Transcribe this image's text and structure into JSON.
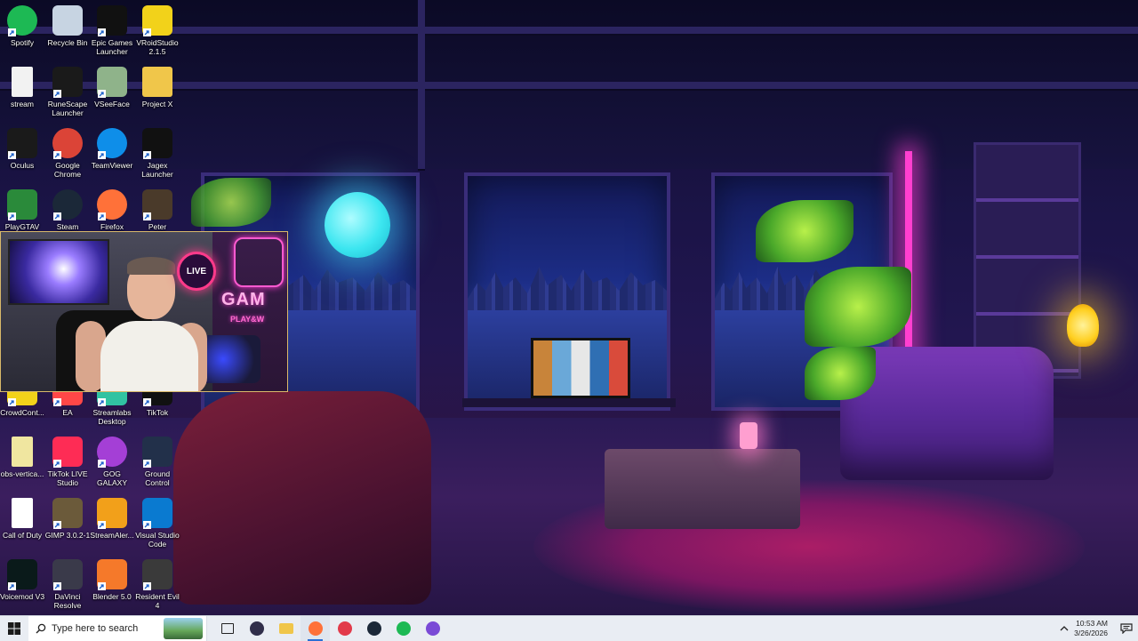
{
  "desktop_icons": [
    {
      "label": "Spotify",
      "icon": "spotify-icon",
      "color": "#1db954"
    },
    {
      "label": "Recycle Bin",
      "icon": "recycle-bin-icon",
      "color": "#c7d4e2"
    },
    {
      "label": "Epic Games Launcher",
      "icon": "epic-games-icon",
      "color": "#111111"
    },
    {
      "label": "VRoidStudio 2.1.5",
      "icon": "vroid-icon",
      "color": "#f2d21a"
    },
    {
      "label": "stream",
      "icon": "file-icon",
      "color": "#f2f2f2"
    },
    {
      "label": "RuneScape Launcher",
      "icon": "runescape-icon",
      "color": "#1a1a1a"
    },
    {
      "label": "VSeeFace",
      "icon": "vseeface-icon",
      "color": "#8fb38a"
    },
    {
      "label": "Project X",
      "icon": "folder-icon",
      "color": "#f0c64a"
    },
    {
      "label": "Oculus",
      "icon": "oculus-icon",
      "color": "#1a1a1a"
    },
    {
      "label": "Google Chrome",
      "icon": "chrome-icon",
      "color": "#db4437"
    },
    {
      "label": "TeamViewer",
      "icon": "teamviewer-icon",
      "color": "#0e8ee9"
    },
    {
      "label": "Jagex Launcher",
      "icon": "jagex-icon",
      "color": "#111111"
    },
    {
      "label": "PlayGTAV",
      "icon": "gtav-icon",
      "color": "#2a8a3a"
    },
    {
      "label": "Steam",
      "icon": "steam-icon",
      "color": "#1b2838"
    },
    {
      "label": "Firefox",
      "icon": "firefox-icon",
      "color": "#ff7139"
    },
    {
      "label": "Peter",
      "icon": "king-kong-icon",
      "color": "#4a3a2a"
    },
    {
      "label": "CrowdCont...",
      "icon": "crowdcontrol-icon",
      "color": "#f2d21a"
    },
    {
      "label": "EA",
      "icon": "ea-icon",
      "color": "#ff4747"
    },
    {
      "label": "Streamlabs Desktop",
      "icon": "streamlabs-icon",
      "color": "#31c3a2"
    },
    {
      "label": "TikTok",
      "icon": "tiktok-icon",
      "color": "#111111"
    },
    {
      "label": "obs-vertica...",
      "icon": "file-icon",
      "color": "#f0e6a0"
    },
    {
      "label": "TikTok LIVE Studio",
      "icon": "tiktok-live-icon",
      "color": "#fe2c55"
    },
    {
      "label": "GOG GALAXY",
      "icon": "gog-icon",
      "color": "#a43fd6"
    },
    {
      "label": "Ground Control",
      "icon": "ground-control-icon",
      "color": "#22304a"
    },
    {
      "label": "Call of Duty",
      "icon": "file-icon",
      "color": "#ffffff"
    },
    {
      "label": "GIMP 3.0.2-1",
      "icon": "gimp-icon",
      "color": "#6b5a3a"
    },
    {
      "label": "StreamAler...",
      "icon": "streamalerts-icon",
      "color": "#f2a01a"
    },
    {
      "label": "Visual Studio Code",
      "icon": "vscode-icon",
      "color": "#0a7ad0"
    },
    {
      "label": "Voicemod V3",
      "icon": "voicemod-icon",
      "color": "#0a1a1a"
    },
    {
      "label": "DaVinci Resolve",
      "icon": "davinci-icon",
      "color": "#3a3a4a"
    },
    {
      "label": "Blender 5.0",
      "icon": "blender-icon",
      "color": "#f5792a"
    },
    {
      "label": "Resident Evil 4",
      "icon": "resident-evil-icon",
      "color": "#3a3a3a"
    }
  ],
  "webcam": {
    "live_badge": "LIVE",
    "neon_sign_text": "GAM",
    "neon_sign_sub": "PLAY&W"
  },
  "taskbar": {
    "search_placeholder": "Type here to search",
    "pinned": [
      {
        "name": "task-view",
        "icon": "task-view-icon",
        "color": "#222222"
      },
      {
        "name": "obs",
        "icon": "obs-icon",
        "color": "#302e4a"
      },
      {
        "name": "file-explorer",
        "icon": "folder-icon",
        "color": "#f0c64a"
      },
      {
        "name": "firefox",
        "icon": "firefox-icon",
        "color": "#ff7139",
        "open": true
      },
      {
        "name": "app-red",
        "icon": "app-icon",
        "color": "#e23a4a"
      },
      {
        "name": "steam",
        "icon": "steam-icon",
        "color": "#1b2838"
      },
      {
        "name": "spotify",
        "icon": "spotify-icon",
        "color": "#1db954"
      },
      {
        "name": "discord-app",
        "icon": "chat-icon",
        "color": "#7a4ad6"
      }
    ],
    "time": "10:53 AM",
    "date": "3/26/2026"
  }
}
